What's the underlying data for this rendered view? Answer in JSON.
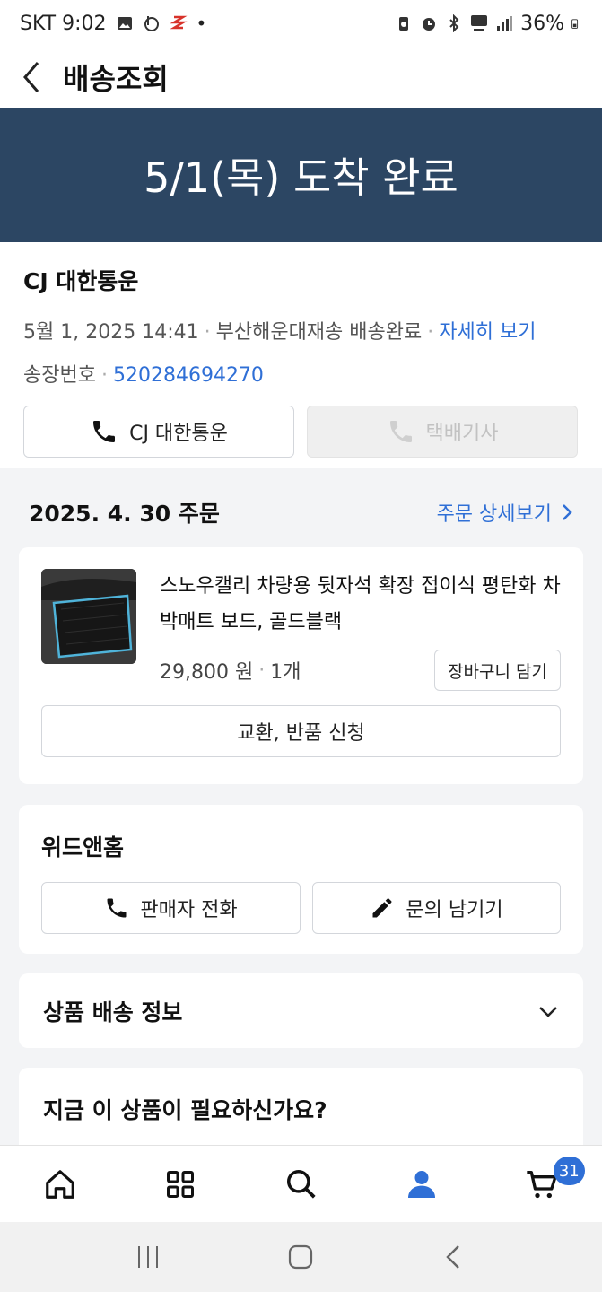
{
  "status_bar": {
    "carrier_time": "SKT 9:02",
    "battery": "36%"
  },
  "header": {
    "title": "배송조회"
  },
  "banner": {
    "text": "5/1(목) 도착 완료"
  },
  "carrier": {
    "name": "CJ 대한통운",
    "delivered_datetime": "5월 1, 2025 14:41",
    "delivered_place": "부산해운대재송 배송완료",
    "detail_link": "자세히 보기",
    "invoice_label": "송장번호",
    "invoice_number": "520284694270",
    "call_carrier_label": "CJ 대한통운",
    "call_driver_label": "택배기사"
  },
  "order": {
    "date_label": "2025. 4. 30 주문",
    "detail_link": "주문 상세보기"
  },
  "product": {
    "name": "스노우캘리 차량용 뒷자석 확장 접이식 평탄화 차박매트 보드, 골드블랙",
    "price": "29,800 원",
    "quantity": "1개",
    "cart_button": "장바구니 담기",
    "return_button": "교환, 반품 신청"
  },
  "seller": {
    "name": "위드앤홈",
    "call_button": "판매자 전화",
    "inquiry_button": "문의 남기기"
  },
  "shipping_info": {
    "label": "상품 배송 정보"
  },
  "recommend": {
    "label": "지금 이 상품이 필요하신가요?"
  },
  "tabbar": {
    "cart_count": "31"
  },
  "colors": {
    "banner": "#2c4663",
    "accent": "#2f6fd6"
  }
}
